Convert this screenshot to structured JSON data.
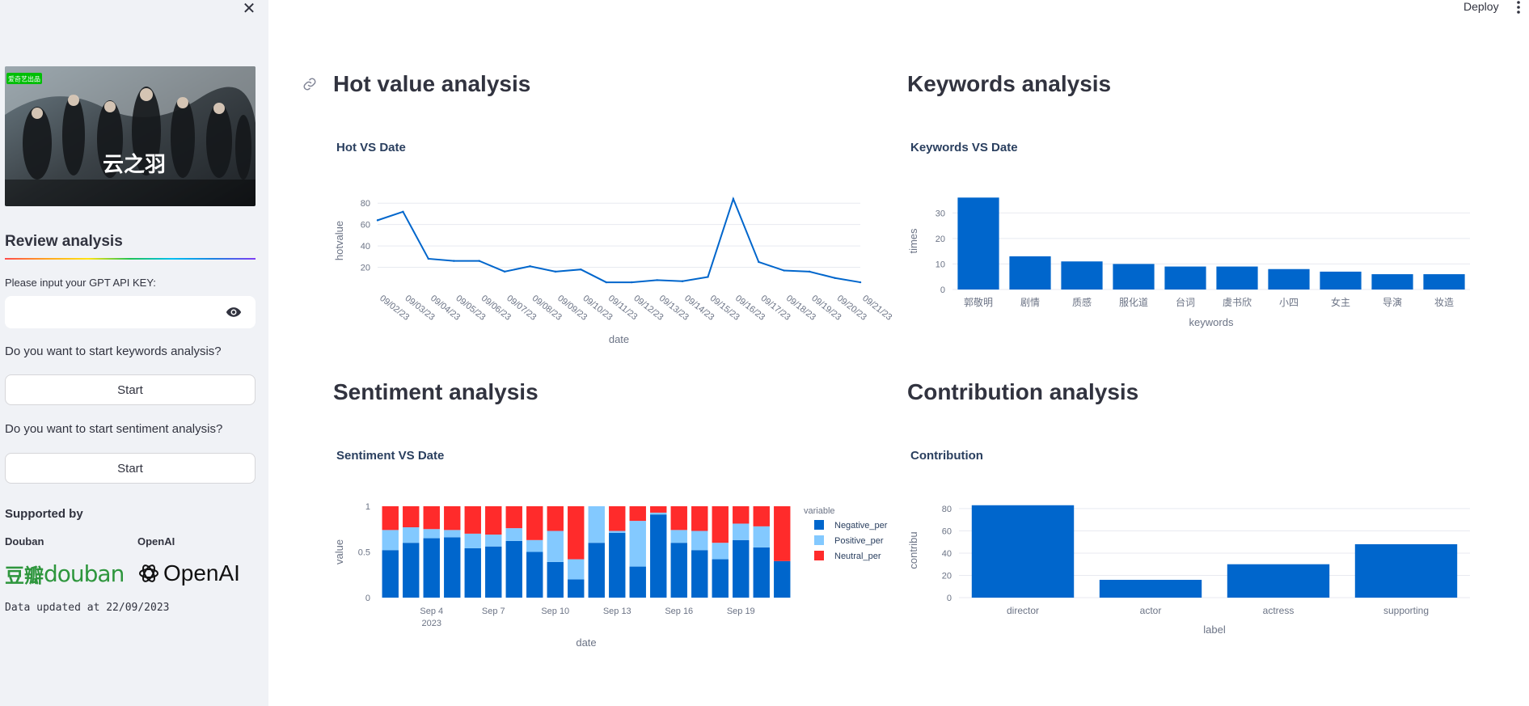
{
  "sidebar": {
    "poster_text": "云之羽",
    "poster_badge": "爱奇艺出品",
    "title": "Review analysis",
    "api_label": "Please input your GPT API KEY:",
    "api_value": "",
    "keywords_question": "Do you want to start keywords analysis?",
    "keywords_button": "Start",
    "sentiment_question": "Do you want to start sentiment analysis?",
    "sentiment_button": "Start",
    "supported_by": "Supported by",
    "douban_label": "Douban",
    "openai_label": "OpenAI",
    "douban_logo_cn": "豆瓣",
    "douban_logo_en": "douban",
    "openai_logo_text": "OpenAI",
    "data_updated": "Data updated at 22/09/2023"
  },
  "header": {
    "deploy_label": "Deploy"
  },
  "sections": {
    "hot": "Hot value analysis",
    "keywords": "Keywords analysis",
    "sentiment": "Sentiment analysis",
    "contribution": "Contribution analysis"
  },
  "colors": {
    "primary": "#0066cc",
    "light": "#83c9ff",
    "red": "#ff2b2b",
    "grid": "#e8eaf0",
    "axis_text": "#6b7385"
  },
  "chart_data": [
    {
      "id": "hot",
      "type": "line",
      "title": "Hot VS Date",
      "xlabel": "date",
      "ylabel": "hotvalue",
      "categories": [
        "09/02/23",
        "09/03/23",
        "09/04/23",
        "09/05/23",
        "09/06/23",
        "09/07/23",
        "09/08/23",
        "09/09/23",
        "09/10/23",
        "09/11/23",
        "09/12/23",
        "09/13/23",
        "09/14/23",
        "09/15/23",
        "09/16/23",
        "09/17/23",
        "09/18/23",
        "09/19/23",
        "09/20/23",
        "09/21/23"
      ],
      "values": [
        64,
        72,
        28,
        26,
        26,
        16,
        21,
        16,
        18,
        6,
        6,
        8,
        7,
        11,
        84,
        25,
        17,
        16,
        10,
        6
      ],
      "ylim": [
        0,
        90
      ],
      "yticks": [
        20,
        40,
        60,
        80
      ]
    },
    {
      "id": "keywords",
      "type": "bar",
      "title": "Keywords VS Date",
      "xlabel": "keywords",
      "ylabel": "times",
      "categories": [
        "郭敬明",
        "剧情",
        "质感",
        "服化道",
        "台词",
        "虞书欣",
        "小四",
        "女主",
        "导演",
        "妆造"
      ],
      "values": [
        36,
        13,
        11,
        10,
        9,
        9,
        8,
        7,
        6,
        6
      ],
      "ylim": [
        0,
        38
      ],
      "yticks": [
        0,
        10,
        20,
        30
      ]
    },
    {
      "id": "sentiment",
      "type": "bar",
      "stacked": true,
      "title": "Sentiment VS Date",
      "xlabel": "date",
      "ylabel": "value",
      "legend_title": "variable",
      "legend_position": "right",
      "x": [
        "2023-09-02",
        "2023-09-03",
        "2023-09-04",
        "2023-09-05",
        "2023-09-06",
        "2023-09-07",
        "2023-09-08",
        "2023-09-09",
        "2023-09-10",
        "2023-09-11",
        "2023-09-12",
        "2023-09-13",
        "2023-09-14",
        "2023-09-15",
        "2023-09-16",
        "2023-09-17",
        "2023-09-18",
        "2023-09-19",
        "2023-09-20",
        "2023-09-21"
      ],
      "xticks": [
        {
          "index": 2,
          "label": "Sep 4",
          "sub": "2023"
        },
        {
          "index": 5,
          "label": "Sep 7",
          "sub": ""
        },
        {
          "index": 8,
          "label": "Sep 10",
          "sub": ""
        },
        {
          "index": 11,
          "label": "Sep 13",
          "sub": ""
        },
        {
          "index": 14,
          "label": "Sep 16",
          "sub": ""
        },
        {
          "index": 17,
          "label": "Sep 19",
          "sub": ""
        }
      ],
      "series": [
        {
          "name": "Negative_per",
          "color": "#0066cc",
          "values": [
            0.52,
            0.6,
            0.65,
            0.66,
            0.54,
            0.56,
            0.62,
            0.5,
            0.39,
            0.2,
            0.6,
            0.71,
            0.34,
            0.91,
            0.6,
            0.52,
            0.42,
            0.63,
            0.55,
            0.4
          ]
        },
        {
          "name": "Positive_per",
          "color": "#83c9ff",
          "values": [
            0.22,
            0.17,
            0.1,
            0.08,
            0.16,
            0.13,
            0.14,
            0.13,
            0.34,
            0.22,
            0.4,
            0.02,
            0.5,
            0.02,
            0.14,
            0.21,
            0.18,
            0.18,
            0.23,
            0.0
          ]
        },
        {
          "name": "Neutral_per",
          "color": "#ff2b2b",
          "values": [
            0.26,
            0.23,
            0.25,
            0.26,
            0.3,
            0.31,
            0.24,
            0.37,
            0.27,
            0.58,
            0.0,
            0.27,
            0.16,
            0.07,
            0.26,
            0.27,
            0.4,
            0.19,
            0.22,
            0.6
          ]
        }
      ],
      "ylim": [
        0,
        1
      ],
      "yticks": [
        0,
        0.5,
        1
      ]
    },
    {
      "id": "contribution",
      "type": "bar",
      "title": "Contribution",
      "xlabel": "label",
      "ylabel": "contribu",
      "categories": [
        "director",
        "actor",
        "actress",
        "supporting"
      ],
      "values": [
        83,
        16,
        30,
        48
      ],
      "ylim": [
        0,
        85
      ],
      "yticks": [
        0,
        20,
        40,
        60,
        80
      ]
    }
  ]
}
